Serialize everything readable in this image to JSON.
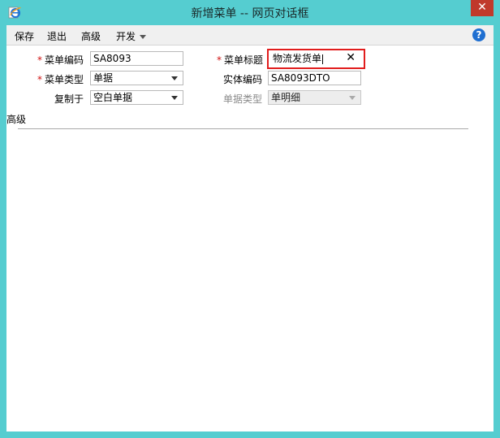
{
  "window": {
    "title": "新增菜单 -- 网页对话框",
    "close_glyph": "✕"
  },
  "toolbar": {
    "save": "保存",
    "exit": "退出",
    "advanced": "高级",
    "develop": "开发"
  },
  "help": {
    "glyph": "?"
  },
  "form": {
    "menu_code": {
      "label": "菜单编码",
      "value": "SA8093",
      "required": true
    },
    "menu_title": {
      "label": "菜单标题",
      "value": "物流发货单",
      "required": true,
      "clear_glyph": "✕"
    },
    "menu_type": {
      "label": "菜单类型",
      "value": "单据",
      "required": true
    },
    "entity_code": {
      "label": "实体编码",
      "value": "SA8093DTO"
    },
    "copy_from": {
      "label": "复制于",
      "value": "空白单据"
    },
    "doc_type": {
      "label": "单据类型",
      "value": "单明细",
      "disabled": true
    }
  },
  "section": {
    "advanced_label": "高级"
  },
  "colors": {
    "window_frame": "#55cdd0",
    "required_star": "#d01010",
    "highlight_border": "#e11d1d",
    "help": "#1f6fd1"
  }
}
